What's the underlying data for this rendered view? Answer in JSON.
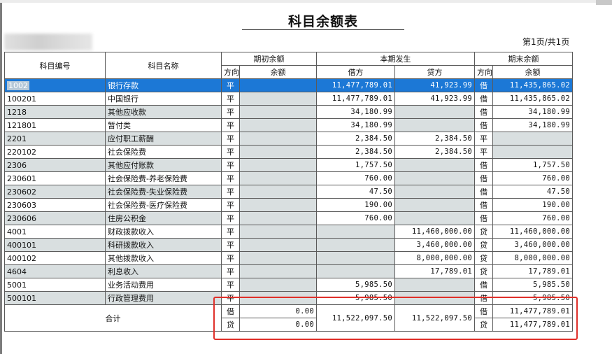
{
  "report": {
    "title": "科目余额表",
    "page_info": "第1页/共1页"
  },
  "headers": {
    "code": "科目编号",
    "name": "科目名称",
    "opening": "期初余额",
    "current": "本期发生",
    "closing": "期末余额",
    "direction": "方向",
    "balance": "余额",
    "debit": "借方",
    "credit": "贷方"
  },
  "rows": [
    {
      "code": "1002",
      "name": "银行存款",
      "open_dir": "平",
      "open_bal": "",
      "debit": "11,477,789.01",
      "credit": "41,923.99",
      "close_dir": "借",
      "close_bal": "11,435,865.02",
      "selected": true
    },
    {
      "code": "100201",
      "name": "中国银行",
      "open_dir": "平",
      "open_bal": "",
      "debit": "11,477,789.01",
      "credit": "41,923.99",
      "close_dir": "借",
      "close_bal": "11,435,865.02"
    },
    {
      "code": "1218",
      "name": "其他应收款",
      "open_dir": "平",
      "open_bal": "",
      "debit": "34,180.99",
      "credit": "",
      "close_dir": "借",
      "close_bal": "34,180.99"
    },
    {
      "code": "121801",
      "name": "暂付类",
      "open_dir": "平",
      "open_bal": "",
      "debit": "34,180.99",
      "credit": "",
      "close_dir": "借",
      "close_bal": "34,180.99"
    },
    {
      "code": "2201",
      "name": "应付职工薪酬",
      "open_dir": "平",
      "open_bal": "",
      "debit": "2,384.50",
      "credit": "2,384.50",
      "close_dir": "平",
      "close_bal": ""
    },
    {
      "code": "220102",
      "name": "社会保险费",
      "open_dir": "平",
      "open_bal": "",
      "debit": "2,384.50",
      "credit": "2,384.50",
      "close_dir": "平",
      "close_bal": ""
    },
    {
      "code": "2306",
      "name": "其他应付账款",
      "open_dir": "平",
      "open_bal": "",
      "debit": "1,757.50",
      "credit": "",
      "close_dir": "借",
      "close_bal": "1,757.50"
    },
    {
      "code": "230601",
      "name": "社会保险费-养老保险费",
      "open_dir": "平",
      "open_bal": "",
      "debit": "760.00",
      "credit": "",
      "close_dir": "借",
      "close_bal": "760.00"
    },
    {
      "code": "230602",
      "name": "社会保险费-失业保险费",
      "open_dir": "平",
      "open_bal": "",
      "debit": "47.50",
      "credit": "",
      "close_dir": "借",
      "close_bal": "47.50"
    },
    {
      "code": "230603",
      "name": "社会保险费-医疗保险费",
      "open_dir": "平",
      "open_bal": "",
      "debit": "190.00",
      "credit": "",
      "close_dir": "借",
      "close_bal": "190.00"
    },
    {
      "code": "230606",
      "name": "住房公积金",
      "open_dir": "平",
      "open_bal": "",
      "debit": "760.00",
      "credit": "",
      "close_dir": "借",
      "close_bal": "760.00"
    },
    {
      "code": "4001",
      "name": "财政拨款收入",
      "open_dir": "平",
      "open_bal": "",
      "debit": "",
      "credit": "11,460,000.00",
      "close_dir": "贷",
      "close_bal": "11,460,000.00"
    },
    {
      "code": "400101",
      "name": "科研拨款收入",
      "open_dir": "平",
      "open_bal": "",
      "debit": "",
      "credit": "3,460,000.00",
      "close_dir": "贷",
      "close_bal": "3,460,000.00"
    },
    {
      "code": "400102",
      "name": "其他拨款收入",
      "open_dir": "平",
      "open_bal": "",
      "debit": "",
      "credit": "8,000,000.00",
      "close_dir": "贷",
      "close_bal": "8,000,000.00"
    },
    {
      "code": "4604",
      "name": "利息收入",
      "open_dir": "平",
      "open_bal": "",
      "debit": "",
      "credit": "17,789.01",
      "close_dir": "贷",
      "close_bal": "17,789.01"
    },
    {
      "code": "5001",
      "name": "业务活动费用",
      "open_dir": "平",
      "open_bal": "",
      "debit": "5,985.50",
      "credit": "",
      "close_dir": "借",
      "close_bal": "5,985.50"
    },
    {
      "code": "500101",
      "name": "行政管理费用",
      "open_dir": "平",
      "open_bal": "",
      "debit": "5,985.50",
      "credit": "",
      "close_dir": "借",
      "close_bal": "5,985.50"
    }
  ],
  "total": {
    "label": "合计",
    "open_debit_dir": "借",
    "open_debit_bal": "0.00",
    "open_credit_dir": "贷",
    "open_credit_bal": "0.00",
    "debit": "11,522,097.50",
    "credit": "11,522,097.50",
    "close_debit_dir": "借",
    "close_debit_bal": "11,477,789.01",
    "close_credit_dir": "贷",
    "close_credit_bal": "11,477,789.01"
  },
  "colors": {
    "selection": "#1c78d6",
    "shaded_cell": "#d9dfe0",
    "highlight_box": "#e0302a"
  }
}
